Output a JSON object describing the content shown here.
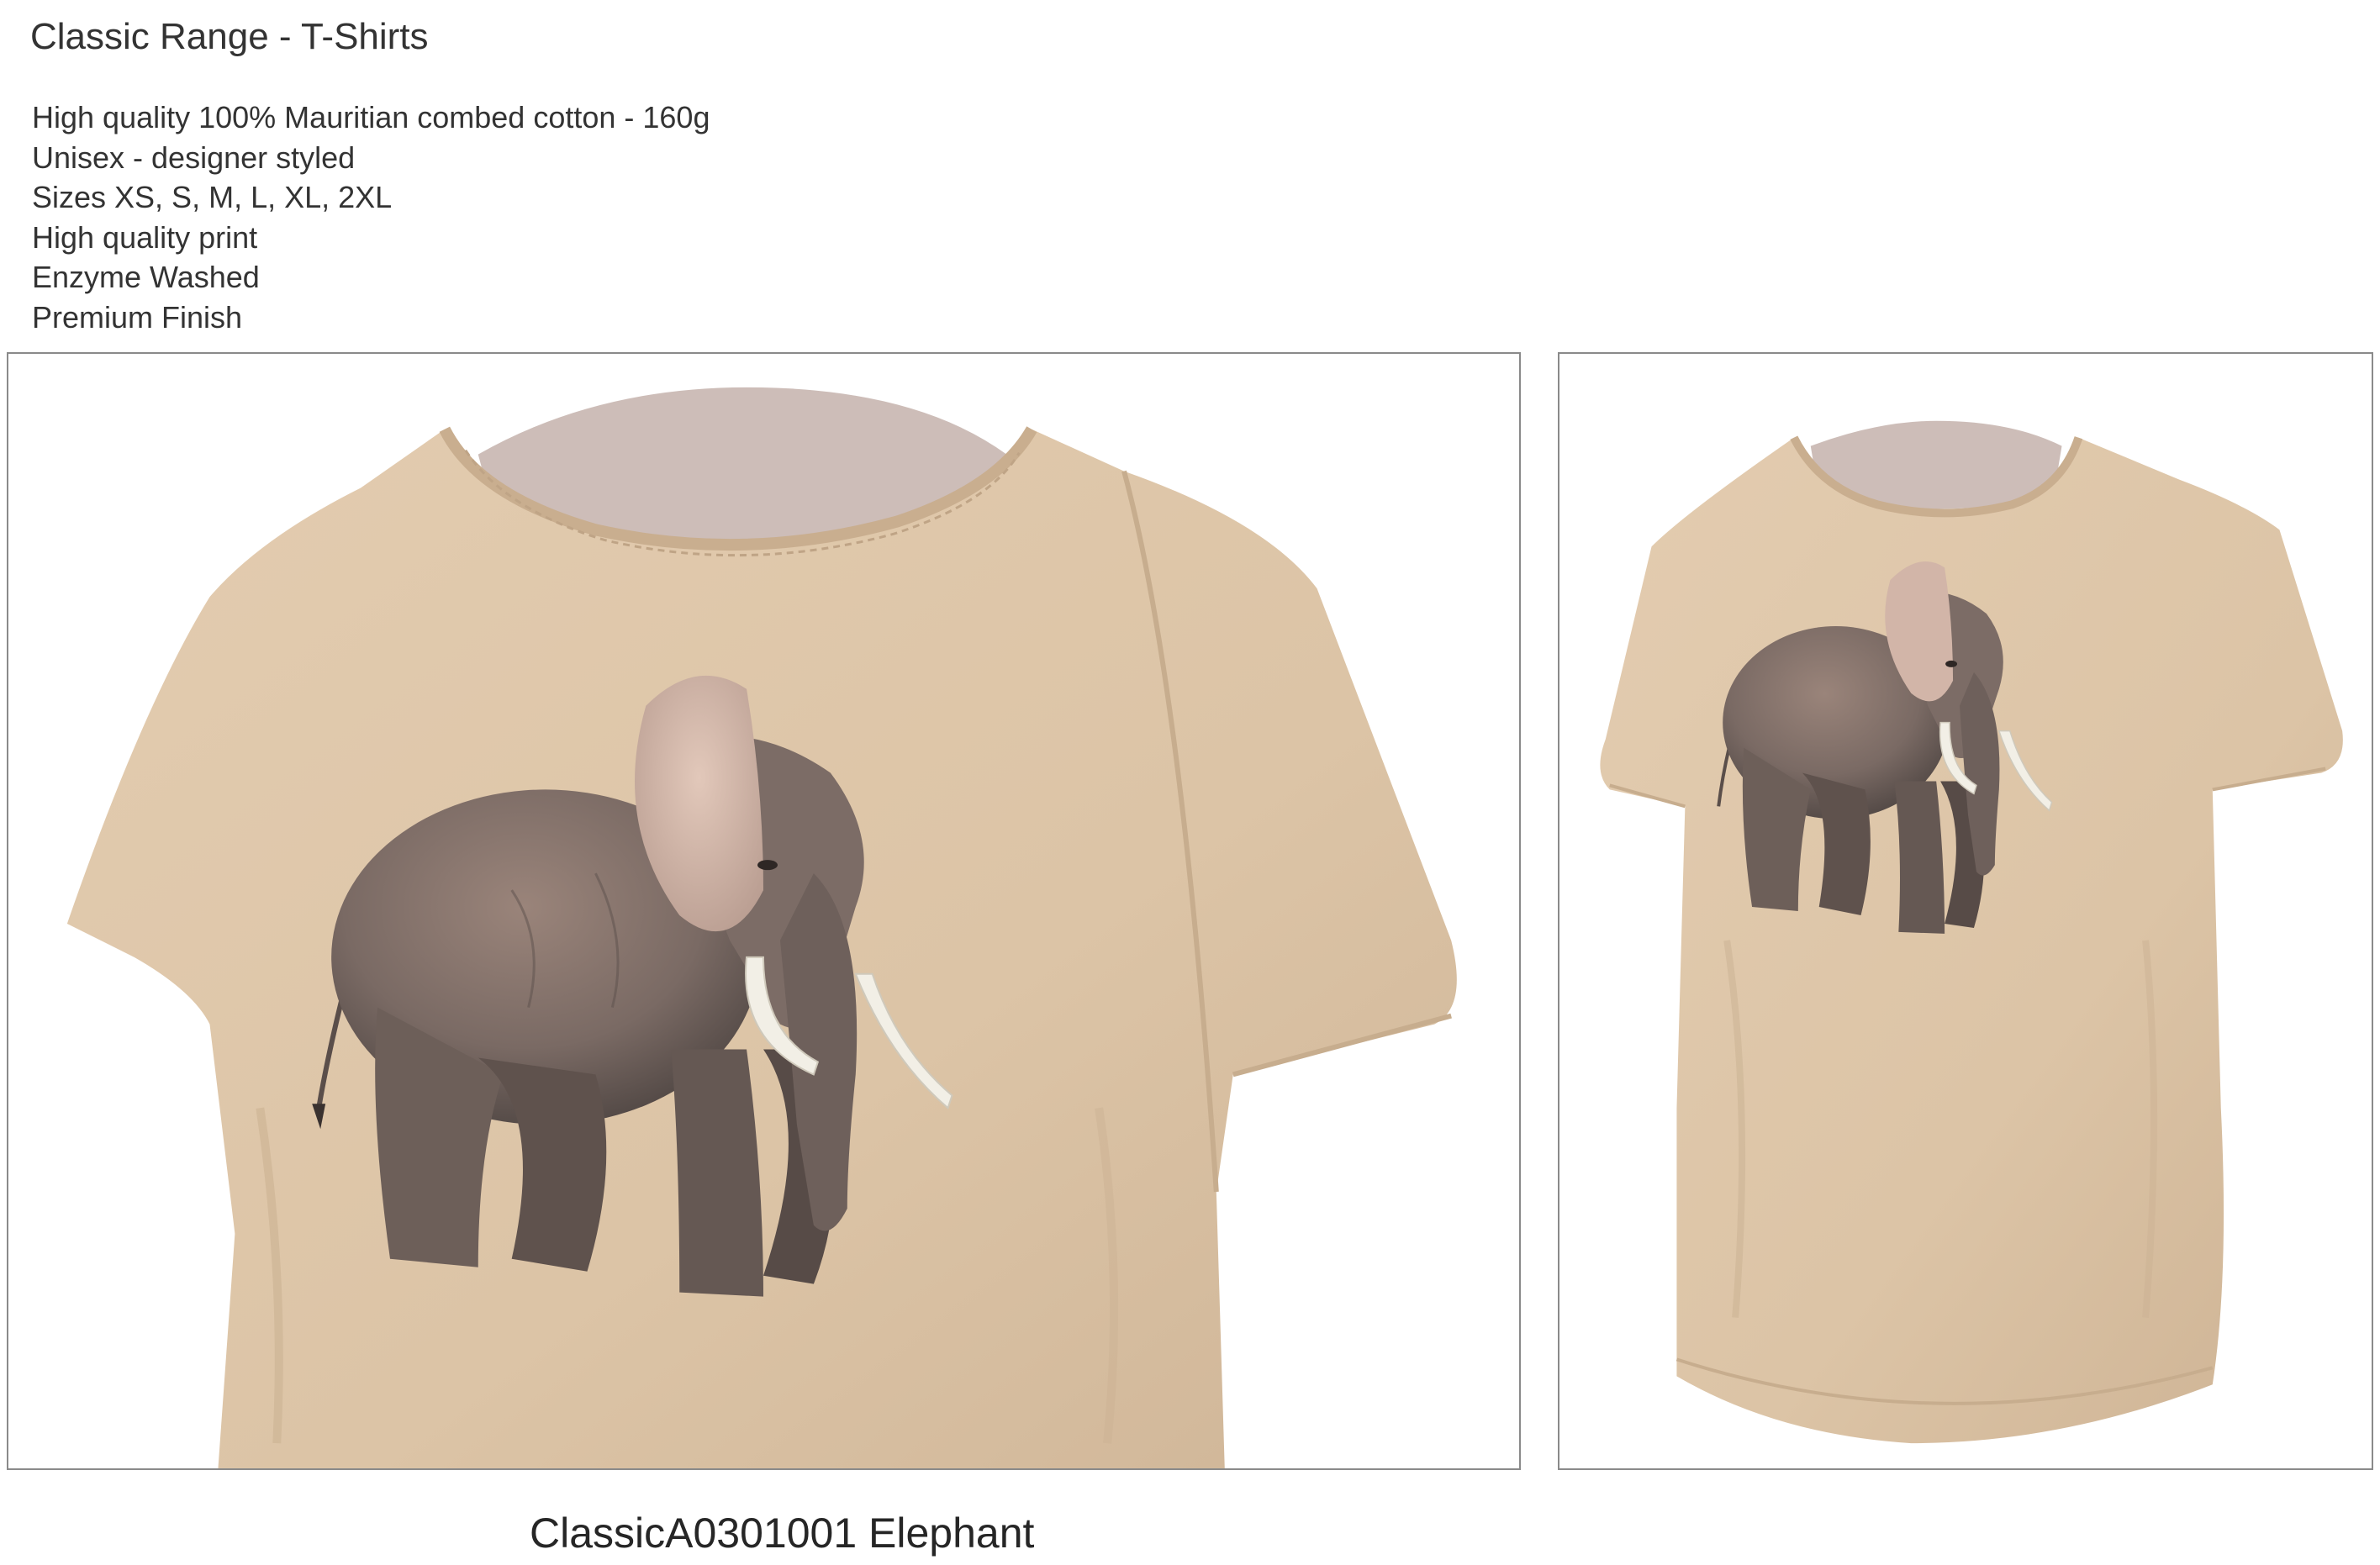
{
  "title": "Classic Range - T-Shirts",
  "features": [
    "High quality 100% Mauritian combed cotton - 160g",
    "Unisex - designer styled",
    "Sizes XS, S, M, L, XL, 2XL",
    "High quality print",
    "Enzyme Washed",
    "Premium Finish"
  ],
  "caption": "ClassicA0301001 Elephant",
  "colors": {
    "shirt": "#dcc4a6",
    "shirt_shadow": "#c7ad8e",
    "collar_inner": "#cdbdb8",
    "elephant_body": "#7d6e68",
    "elephant_ear": "#d2b5a8",
    "tusk": "#f2efe6",
    "frame_border": "#8a8a8a"
  },
  "icons": [
    "tshirt-closeup-photo",
    "tshirt-full-photo",
    "elephant-print"
  ]
}
